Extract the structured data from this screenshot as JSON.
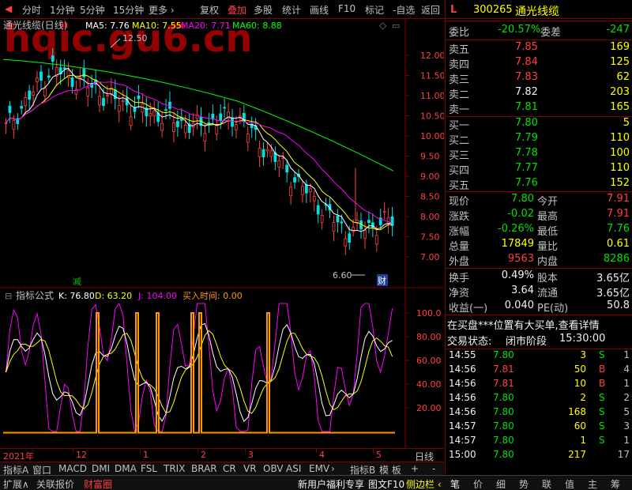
{
  "toolbar": {
    "left": [
      "分时",
      "1分钟",
      "5分钟",
      "15分钟",
      "更多 ›"
    ],
    "right": [
      "复权",
      "叠加",
      "多股",
      "统计",
      "画线",
      "F10",
      "标记",
      "-自选",
      "返回"
    ],
    "active": "叠加"
  },
  "chart": {
    "title": "通光线缆(日线)",
    "ma_labels": [
      {
        "text": "MA5: 7.76",
        "color": "#ffffff"
      },
      {
        "text": "MA10: 7.55",
        "color": "#ffff00"
      },
      {
        "text": "MA20: 7.71",
        "color": "#ff00ff"
      },
      {
        "text": "MA60: 8.88",
        "color": "#00ff00"
      }
    ],
    "price_ticks": [
      "12.00",
      "11.50",
      "11.00",
      "10.50",
      "10.00",
      "9.50",
      "9.00",
      "8.50",
      "8.00",
      "7.50",
      "7.00"
    ],
    "high_label": "12.50",
    "low_label": "6.60",
    "marker_jian": "减",
    "marker_cai": "财",
    "watermark": "hqic.gu6.cn"
  },
  "indicator": {
    "name": "指标公式",
    "values": [
      {
        "text": "K: 76.80",
        "color": "#ffffff"
      },
      {
        "text": "D: 63.20",
        "color": "#ffff00"
      },
      {
        "text": "J: 104.00",
        "color": "#ff00ff"
      },
      {
        "text": "买入时间: 0.00",
        "color": "#ff9900"
      }
    ],
    "ticks": [
      "100.0",
      "80.00",
      "60.00",
      "40.00",
      "20.00"
    ]
  },
  "time_axis": {
    "labels": [
      "2021年",
      "12",
      "1",
      "2",
      "3",
      "4",
      "5"
    ],
    "period": "日线"
  },
  "bottom_tabs": [
    "指标A",
    "窗口",
    "MACD",
    "DMI",
    "DMA",
    "FSL",
    "TRIX",
    "BRAR",
    "CR",
    "VR",
    "OBV",
    "ASI",
    "EMV",
    "›",
    "指标B",
    "模 板",
    "+",
    "-"
  ],
  "footer": {
    "left": [
      "扩展∧",
      "关联报价",
      "财富圈"
    ],
    "mid": [
      "新用户福利专享",
      "图文F10",
      "侧边栏 ‹"
    ],
    "right": [
      "笔",
      "价",
      "细",
      "势",
      "联",
      "值",
      "主",
      "筹"
    ]
  },
  "quote": {
    "flag": "L",
    "code": "300265",
    "name": "通光线缆",
    "weibi_label": "委比",
    "weibi": "-20.57%",
    "weicha_label": "委差",
    "weicha": "-247",
    "asks": [
      {
        "label": "卖五",
        "price": "7.85",
        "vol": "169"
      },
      {
        "label": "卖四",
        "price": "7.84",
        "vol": "125"
      },
      {
        "label": "卖三",
        "price": "7.83",
        "vol": "62"
      },
      {
        "label": "卖二",
        "price": "7.82",
        "vol": "203"
      },
      {
        "label": "卖一",
        "price": "7.81",
        "vol": "165"
      }
    ],
    "bids": [
      {
        "label": "买一",
        "price": "7.80",
        "vol": "5"
      },
      {
        "label": "买二",
        "price": "7.79",
        "vol": "110"
      },
      {
        "label": "买三",
        "price": "7.78",
        "vol": "100"
      },
      {
        "label": "买四",
        "price": "7.77",
        "vol": "110"
      },
      {
        "label": "买五",
        "price": "7.76",
        "vol": "152"
      }
    ],
    "stats": [
      {
        "l1": "现价",
        "v1": "7.80",
        "c1": "green",
        "l2": "今开",
        "v2": "7.91",
        "c2": "red"
      },
      {
        "l1": "涨跌",
        "v1": "-0.02",
        "c1": "green",
        "l2": "最高",
        "v2": "7.91",
        "c2": "red"
      },
      {
        "l1": "涨幅",
        "v1": "-0.26%",
        "c1": "green",
        "l2": "最低",
        "v2": "7.76",
        "c2": "green"
      },
      {
        "l1": "总量",
        "v1": "17849",
        "c1": "yellow",
        "l2": "量比",
        "v2": "0.61",
        "c2": "yellow"
      },
      {
        "l1": "外盘",
        "v1": "9563",
        "c1": "red",
        "l2": "内盘",
        "v2": "8286",
        "c2": "green"
      }
    ],
    "stats2": [
      {
        "l1": "换手",
        "v1": "0.49%",
        "l2": "股本",
        "v2": "3.65亿"
      },
      {
        "l1": "净资",
        "v1": "3.64",
        "l2": "流通",
        "v2": "3.65亿"
      },
      {
        "l1": "收益(一)",
        "v1": "0.040",
        "l2": "PE(动)",
        "v2": "50.8"
      }
    ],
    "notice": "在买盘***位置有大买单,查看详情",
    "status_label": "交易状态:",
    "status": "闭市阶段",
    "status_time": "15:30:00",
    "ticks": [
      {
        "time": "14:55",
        "price": "7.80",
        "vol": "3",
        "side": "S",
        "n": "1"
      },
      {
        "time": "14:56",
        "price": "7.81",
        "vol": "50",
        "side": "B",
        "n": "4"
      },
      {
        "time": "14:56",
        "price": "7.81",
        "vol": "10",
        "side": "B",
        "n": "1"
      },
      {
        "time": "14:56",
        "price": "7.80",
        "vol": "2",
        "side": "S",
        "n": "2"
      },
      {
        "time": "14:56",
        "price": "7.80",
        "vol": "168",
        "side": "S",
        "n": "5"
      },
      {
        "time": "14:57",
        "price": "7.80",
        "vol": "60",
        "side": "S",
        "n": "3"
      },
      {
        "time": "14:57",
        "price": "7.80",
        "vol": "1",
        "side": "S",
        "n": "1"
      },
      {
        "time": "15:00",
        "price": "7.80",
        "vol": "217",
        "side": "",
        "n": "17"
      }
    ]
  },
  "colors": {
    "up": "#ff4040",
    "down": "#00e0e0",
    "border": "#800000",
    "ma5": "#ffffff",
    "ma10": "#ffff00",
    "ma20": "#ff00ff",
    "ma60": "#00ff00",
    "buy_signal": "#ff9900"
  }
}
